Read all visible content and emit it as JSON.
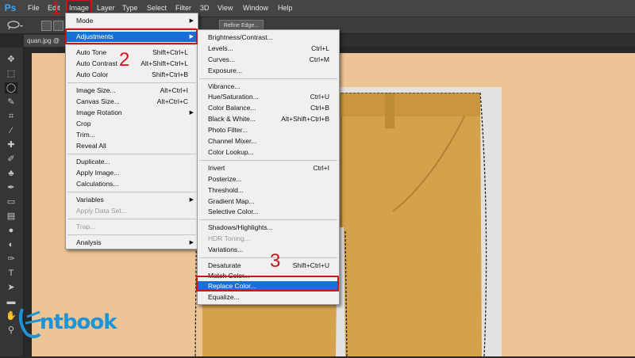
{
  "app": {
    "logo": "Ps"
  },
  "menubar": {
    "items": [
      "File",
      "Edit",
      "Image",
      "Layer",
      "Type",
      "Select",
      "Filter",
      "3D",
      "View",
      "Window",
      "Help"
    ],
    "active_index": 2
  },
  "optionsbar": {
    "refine_edge": "Refine Edge..."
  },
  "document": {
    "tab": "quan.jpg @"
  },
  "image_menu": {
    "items": [
      {
        "label": "Mode",
        "shortcut": "",
        "submenu": true
      },
      {
        "label": "Adjustments",
        "shortcut": "",
        "submenu": true,
        "highlighted": true
      },
      {
        "label": "Auto Tone",
        "shortcut": "Shift+Ctrl+L"
      },
      {
        "label": "Auto Contrast",
        "shortcut": "Alt+Shift+Ctrl+L"
      },
      {
        "label": "Auto Color",
        "shortcut": "Shift+Ctrl+B"
      },
      {
        "label": "Image Size...",
        "shortcut": "Alt+Ctrl+I"
      },
      {
        "label": "Canvas Size...",
        "shortcut": "Alt+Ctrl+C"
      },
      {
        "label": "Image Rotation",
        "shortcut": "",
        "submenu": true
      },
      {
        "label": "Crop",
        "shortcut": ""
      },
      {
        "label": "Trim...",
        "shortcut": ""
      },
      {
        "label": "Reveal All",
        "shortcut": ""
      },
      {
        "label": "Duplicate...",
        "shortcut": ""
      },
      {
        "label": "Apply Image...",
        "shortcut": ""
      },
      {
        "label": "Calculations...",
        "shortcut": ""
      },
      {
        "label": "Variables",
        "shortcut": "",
        "submenu": true
      },
      {
        "label": "Apply Data Set...",
        "shortcut": "",
        "disabled": true
      },
      {
        "label": "Trap...",
        "shortcut": "",
        "disabled": true
      },
      {
        "label": "Analysis",
        "shortcut": "",
        "submenu": true
      }
    ]
  },
  "adjustments_menu": {
    "items": [
      {
        "label": "Brightness/Contrast...",
        "shortcut": ""
      },
      {
        "label": "Levels...",
        "shortcut": "Ctrl+L"
      },
      {
        "label": "Curves...",
        "shortcut": "Ctrl+M"
      },
      {
        "label": "Exposure...",
        "shortcut": ""
      },
      {
        "label": "Vibrance...",
        "shortcut": ""
      },
      {
        "label": "Hue/Saturation...",
        "shortcut": "Ctrl+U"
      },
      {
        "label": "Color Balance...",
        "shortcut": "Ctrl+B"
      },
      {
        "label": "Black & White...",
        "shortcut": "Alt+Shift+Ctrl+B"
      },
      {
        "label": "Photo Filter...",
        "shortcut": ""
      },
      {
        "label": "Channel Mixer...",
        "shortcut": ""
      },
      {
        "label": "Color Lookup...",
        "shortcut": ""
      },
      {
        "label": "Invert",
        "shortcut": "Ctrl+I"
      },
      {
        "label": "Posterize...",
        "shortcut": ""
      },
      {
        "label": "Threshold...",
        "shortcut": ""
      },
      {
        "label": "Gradient Map...",
        "shortcut": ""
      },
      {
        "label": "Selective Color...",
        "shortcut": ""
      },
      {
        "label": "Shadows/Highlights...",
        "shortcut": ""
      },
      {
        "label": "HDR Toning...",
        "shortcut": "",
        "disabled": true
      },
      {
        "label": "Variations...",
        "shortcut": ""
      },
      {
        "label": "Desaturate",
        "shortcut": "Shift+Ctrl+U"
      },
      {
        "label": "Match Color...",
        "shortcut": ""
      },
      {
        "label": "Replace Color...",
        "shortcut": "",
        "highlighted": true
      },
      {
        "label": "Equalize...",
        "shortcut": ""
      }
    ]
  },
  "steps": [
    "1",
    "2",
    "3"
  ],
  "watermark": {
    "text": "ntbook"
  },
  "colors": {
    "highlight": "#1770d6",
    "annotation_red": "#d0121a",
    "canvas_bg": "#ecc496",
    "pants": "#d4a24c",
    "brand_blue": "#1e93d6"
  }
}
